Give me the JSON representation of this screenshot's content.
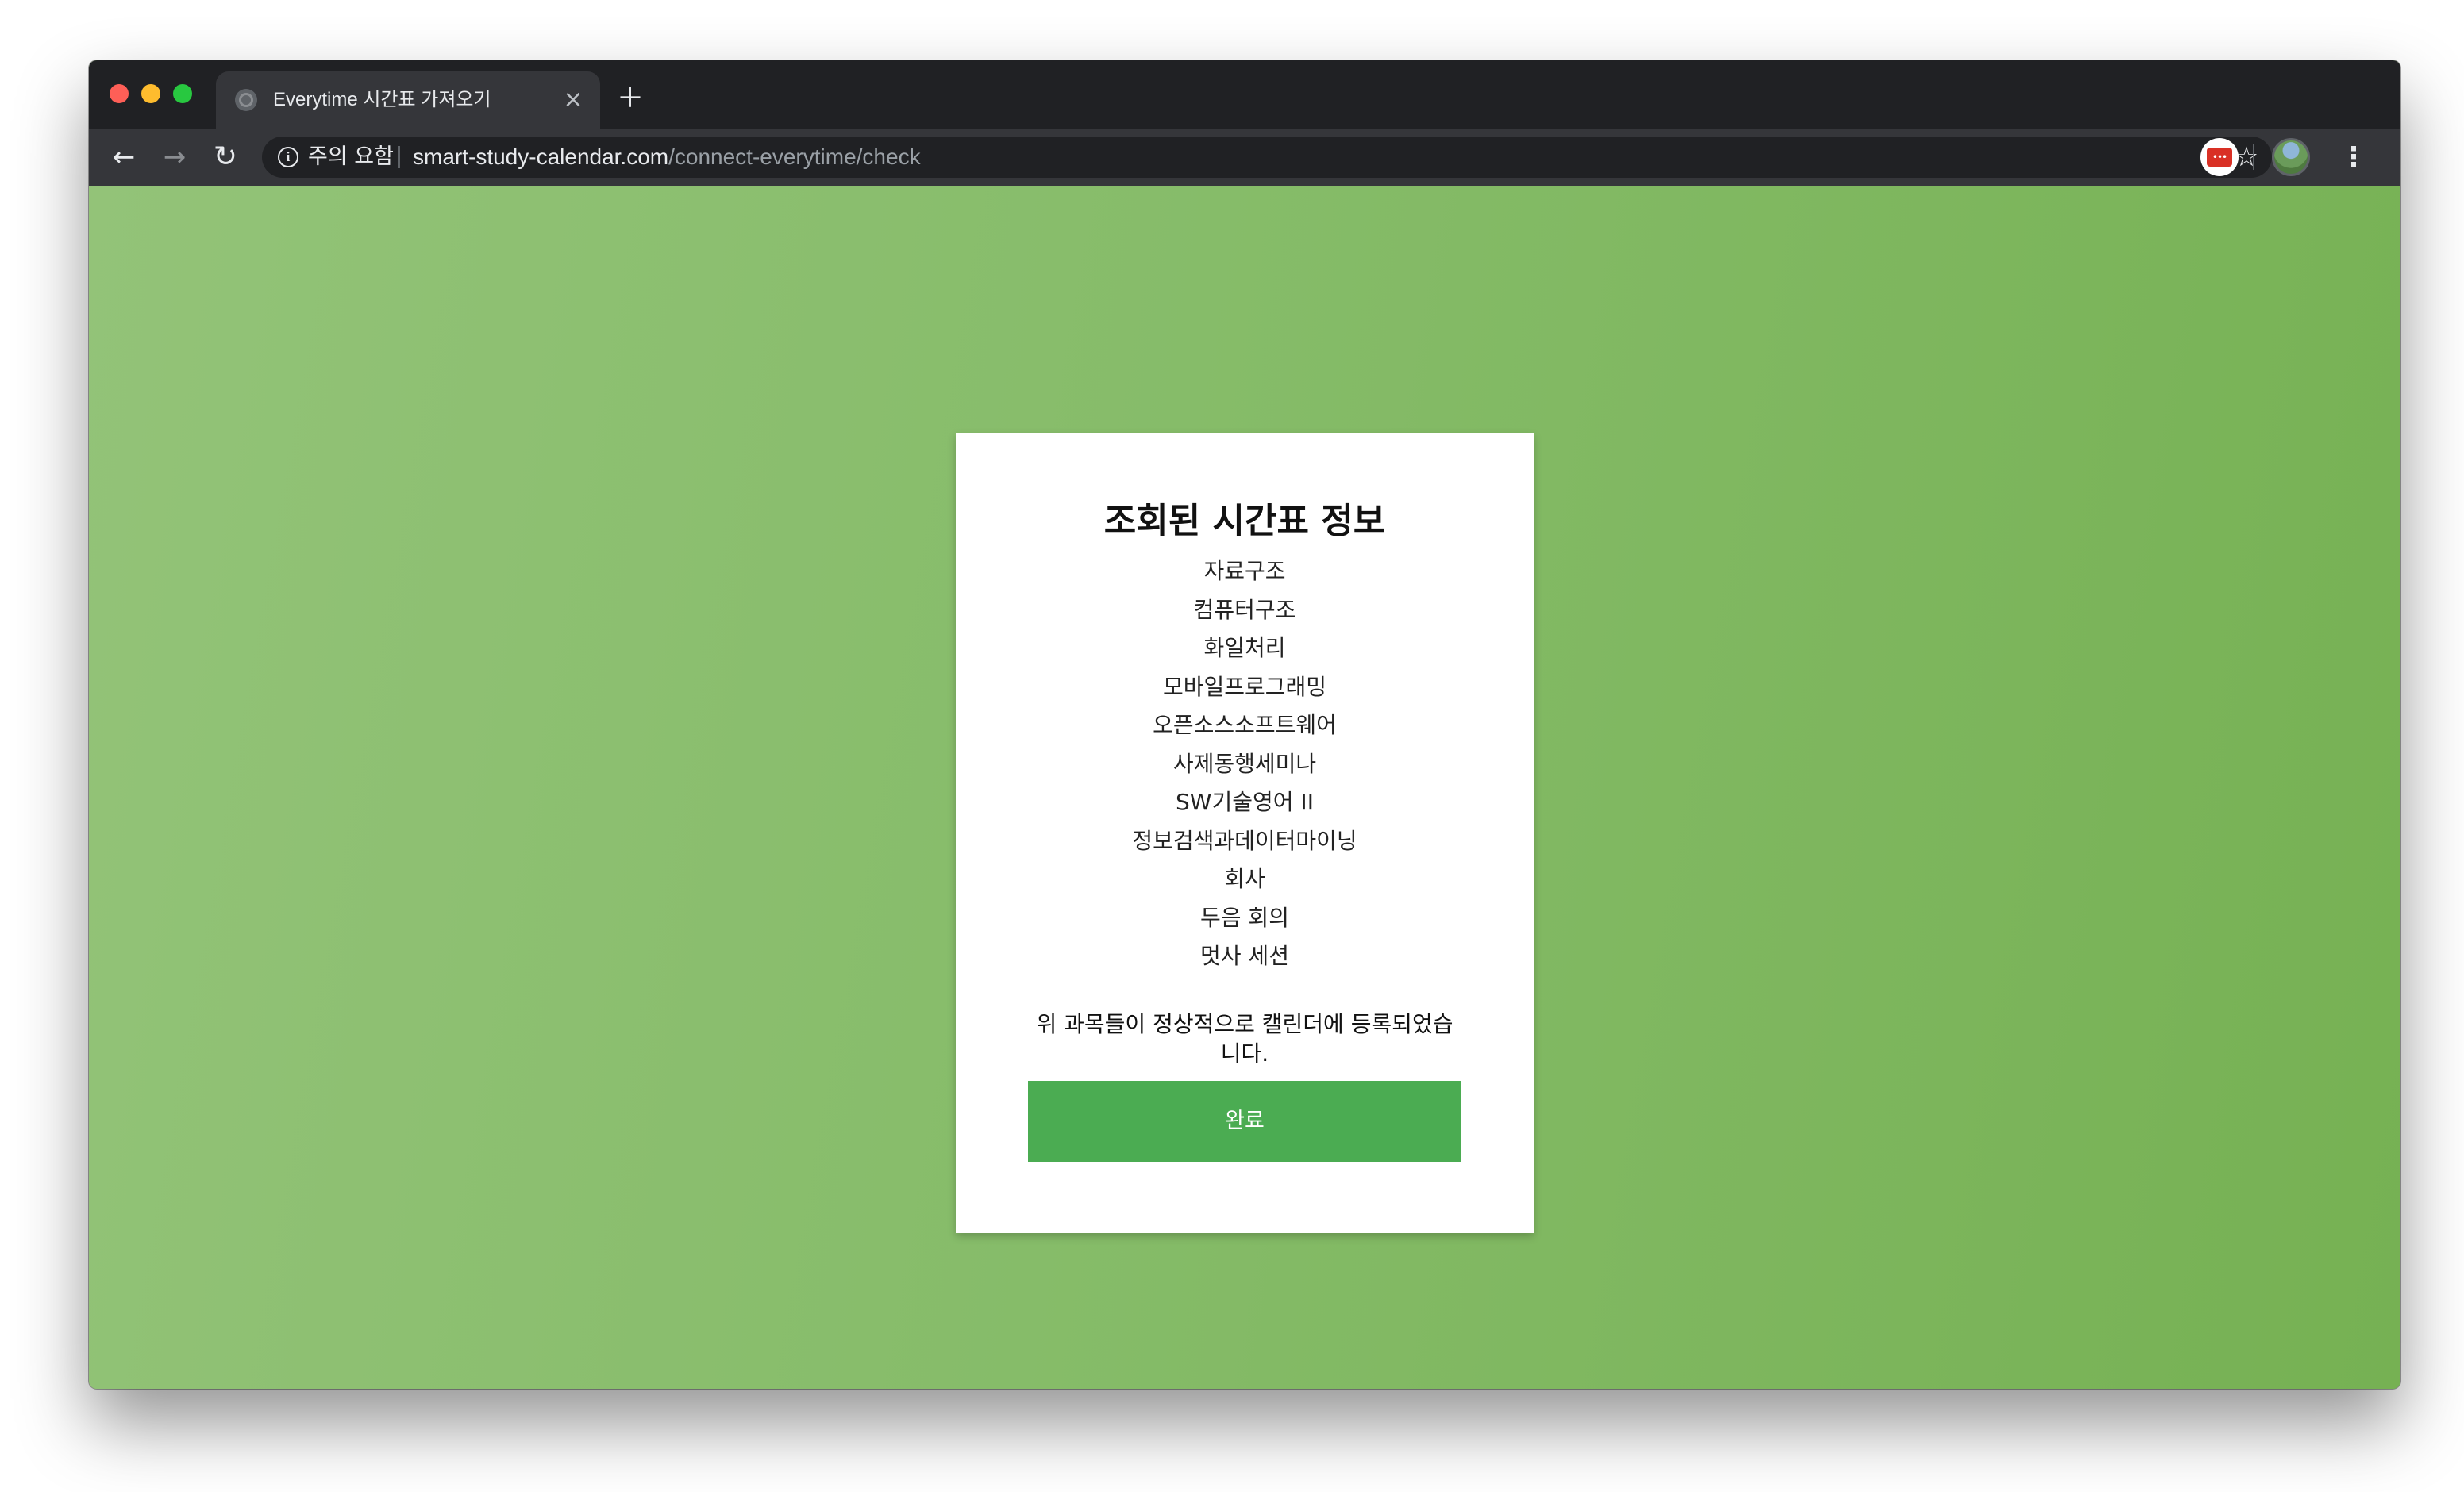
{
  "browser": {
    "tab_title": "Everytime 시간표 가져오기",
    "tab_close_glyph": "×",
    "new_tab_glyph": "+",
    "security_label": "주의 요함",
    "url_host": "smart-study-calendar.com",
    "url_path": "/connect-everytime/check",
    "icons": [
      "back-arrow-icon",
      "forward-arrow-icon",
      "reload-icon",
      "info-icon",
      "star-icon",
      "extension-icon",
      "avatar",
      "more-menu-icon"
    ]
  },
  "page": {
    "background_colors": [
      "#93c378",
      "#76b153"
    ],
    "title": "조회된 시간표 정보",
    "courses": [
      "자료구조",
      "컴퓨터구조",
      "화일처리",
      "모바일프로그래밍",
      "오픈소스소프트웨어",
      "사제동행세미나",
      "SW기술영어 II",
      "정보검색과데이터마이닝",
      "회사",
      "두음 회의",
      "멋사 세션"
    ],
    "confirm_text": "위 과목들이 정상적으로 캘린더에 등록되었습니다.",
    "done_button_label": "완료",
    "accent_color": "#4bac52"
  }
}
